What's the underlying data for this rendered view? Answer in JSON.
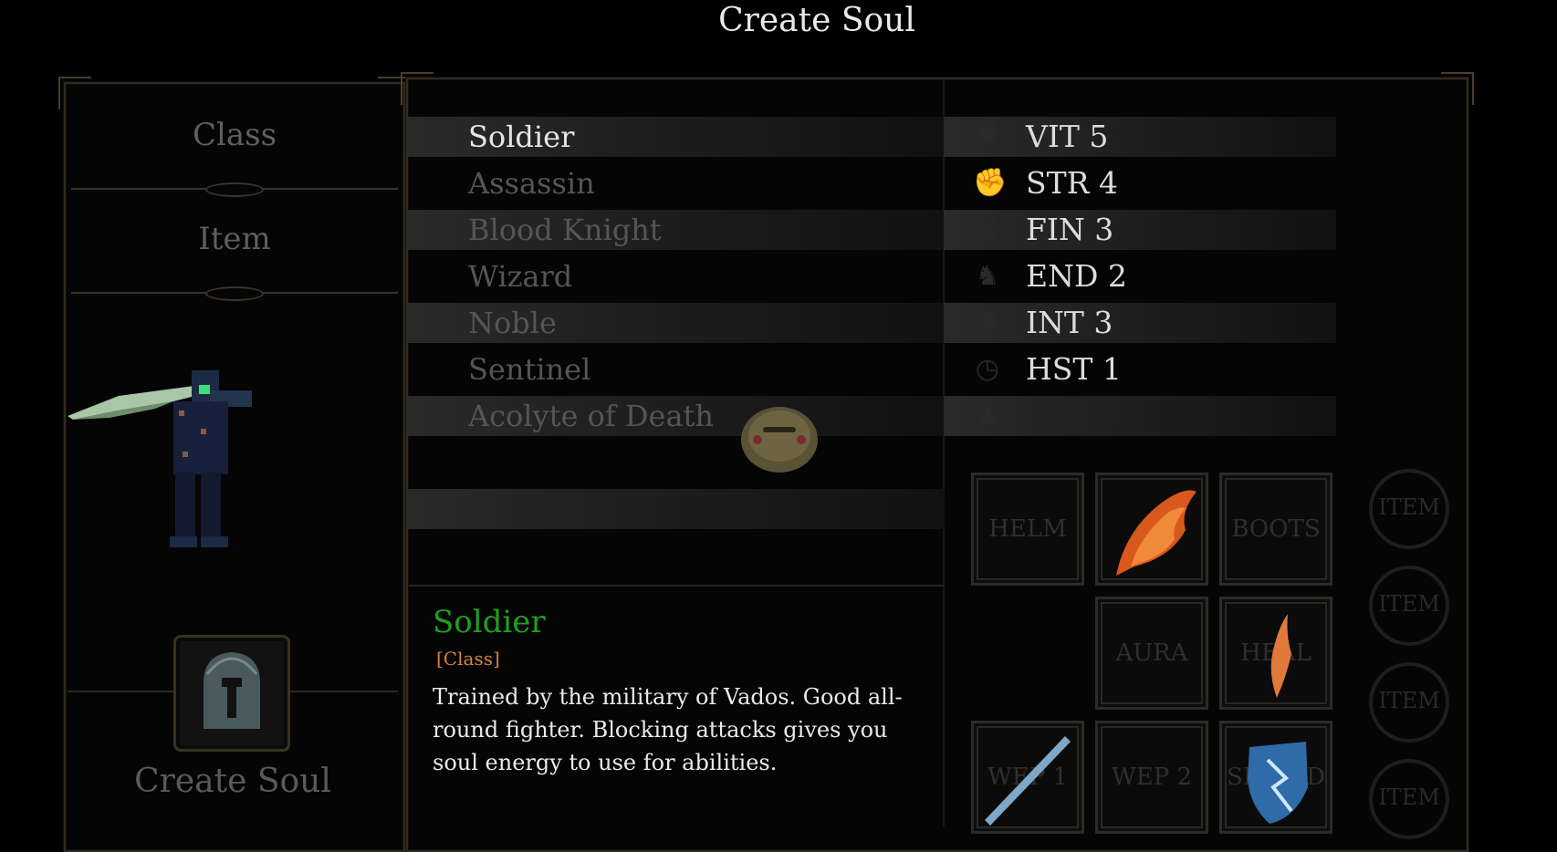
{
  "title": "Create Soul",
  "left_panel": {
    "tabs": [
      "Class",
      "Item"
    ],
    "create_button": "Create Soul"
  },
  "class_list": {
    "selected": "Soldier",
    "items": [
      "Soldier",
      "Assassin",
      "Blood Knight",
      "Wizard",
      "Noble",
      "Sentinel",
      "Acolyte of Death"
    ]
  },
  "stats": [
    {
      "label": "VIT 5",
      "icon": "heart-icon"
    },
    {
      "label": "STR 4",
      "icon": "fist-icon"
    },
    {
      "label": "FIN 3",
      "icon": "blade-icon"
    },
    {
      "label": "END 2",
      "icon": "leg-icon"
    },
    {
      "label": "INT 3",
      "icon": "brain-icon"
    },
    {
      "label": "HST 1",
      "icon": "clock-icon"
    },
    {
      "label": "",
      "icon": "figure-icon"
    }
  ],
  "description": {
    "name": "Soldier",
    "type": "[Class]",
    "text": "Trained by the military of Vados. Good all-round fighter. Blocking attacks gives you soul energy to use for abilities."
  },
  "equipment_slots": {
    "helm": "HELM",
    "cape": "",
    "boots": "BOOTS",
    "aura": "AURA",
    "heal": "HEAL",
    "wep1": "WEP 1",
    "wep2": "WEP 2",
    "shield": "SHIELD"
  },
  "item_rings": [
    "ITEM",
    "ITEM",
    "ITEM",
    "ITEM"
  ],
  "colors": {
    "accent_name": "#1fa01f",
    "accent_type": "#d9823a",
    "frame": "#332a20"
  }
}
